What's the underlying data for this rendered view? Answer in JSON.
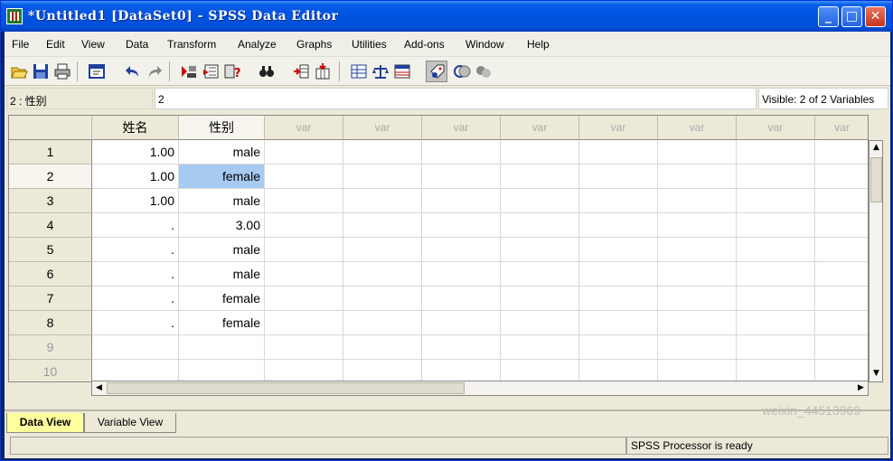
{
  "window": {
    "title": "*Untitled1 [DataSet0] - SPSS Data Editor"
  },
  "menubar": {
    "items": [
      "File",
      "Edit",
      "View",
      "Data",
      "Transform",
      "Analyze",
      "Graphs",
      "Utilities",
      "Add-ons",
      "Window",
      "Help"
    ]
  },
  "toolbar": {
    "icons": [
      "open-icon",
      "save-icon",
      "print-icon",
      "dialog-recall-icon",
      "undo-icon",
      "redo-icon",
      "goto-case-icon",
      "variables-icon",
      "find-icon",
      "insert-cases-icon",
      "insert-variable-icon",
      "split-file-icon",
      "weight-cases-icon",
      "select-cases-icon",
      "value-labels-icon",
      "use-sets-icon",
      "show-all-variables-icon"
    ]
  },
  "cellbar": {
    "ref": "2 : 性别",
    "value": "2",
    "visible": "Visible: 2 of 2 Variables"
  },
  "grid": {
    "columns": [
      "姓名",
      "性别",
      "var",
      "var",
      "var",
      "var",
      "var",
      "var",
      "var",
      "var"
    ],
    "row_numbers": [
      "1",
      "2",
      "3",
      "4",
      "5",
      "6",
      "7",
      "8",
      "9",
      "10"
    ],
    "cells": [
      [
        "1.00",
        "male"
      ],
      [
        "1.00",
        "female"
      ],
      [
        "1.00",
        "male"
      ],
      [
        ".",
        "3.00"
      ],
      [
        ".",
        "male"
      ],
      [
        ".",
        "male"
      ],
      [
        ".",
        "female"
      ],
      [
        ".",
        "female"
      ],
      [
        "",
        ""
      ],
      [
        "",
        ""
      ]
    ],
    "selected": {
      "row": 2,
      "column": "性别"
    }
  },
  "tabs": {
    "data_view": "Data View",
    "variable_view": "Variable View",
    "active": "Data View"
  },
  "status": {
    "processor": "SPSS  Processor is ready"
  },
  "watermark": "weixin_44513969",
  "colors": {
    "titlebar": "#0054e3",
    "selection": "#a6caf0",
    "active_tab": "#ffff9e"
  }
}
